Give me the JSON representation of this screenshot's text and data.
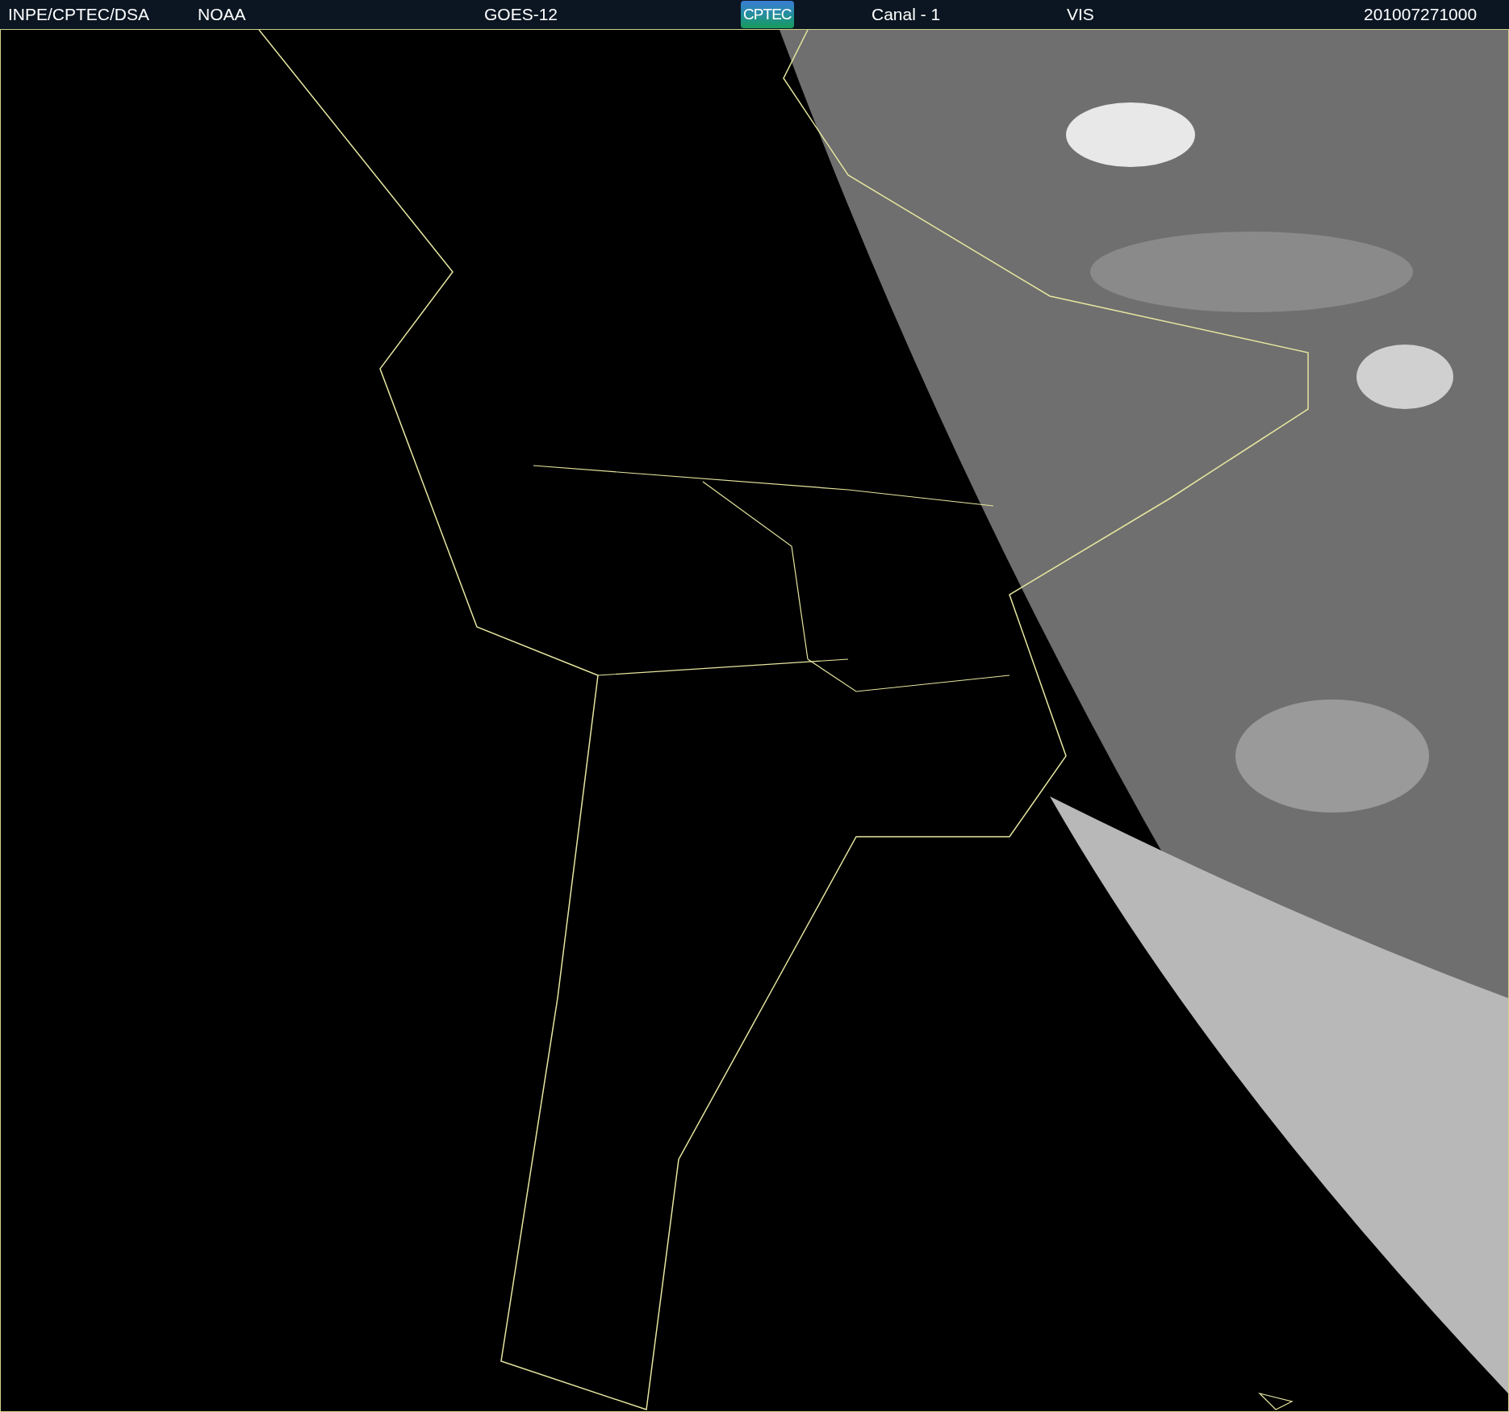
{
  "header": {
    "items": [
      {
        "kind": "text",
        "text": "INPE/CPTEC/DSA"
      },
      {
        "kind": "text",
        "text": "NOAA"
      },
      {
        "kind": "text",
        "text": "GOES-12"
      },
      {
        "kind": "logo",
        "text": "CPTEC"
      },
      {
        "kind": "text",
        "text": "Canal - 1"
      },
      {
        "kind": "text",
        "text": "VIS"
      },
      {
        "kind": "text",
        "text": "201007271000"
      }
    ]
  }
}
